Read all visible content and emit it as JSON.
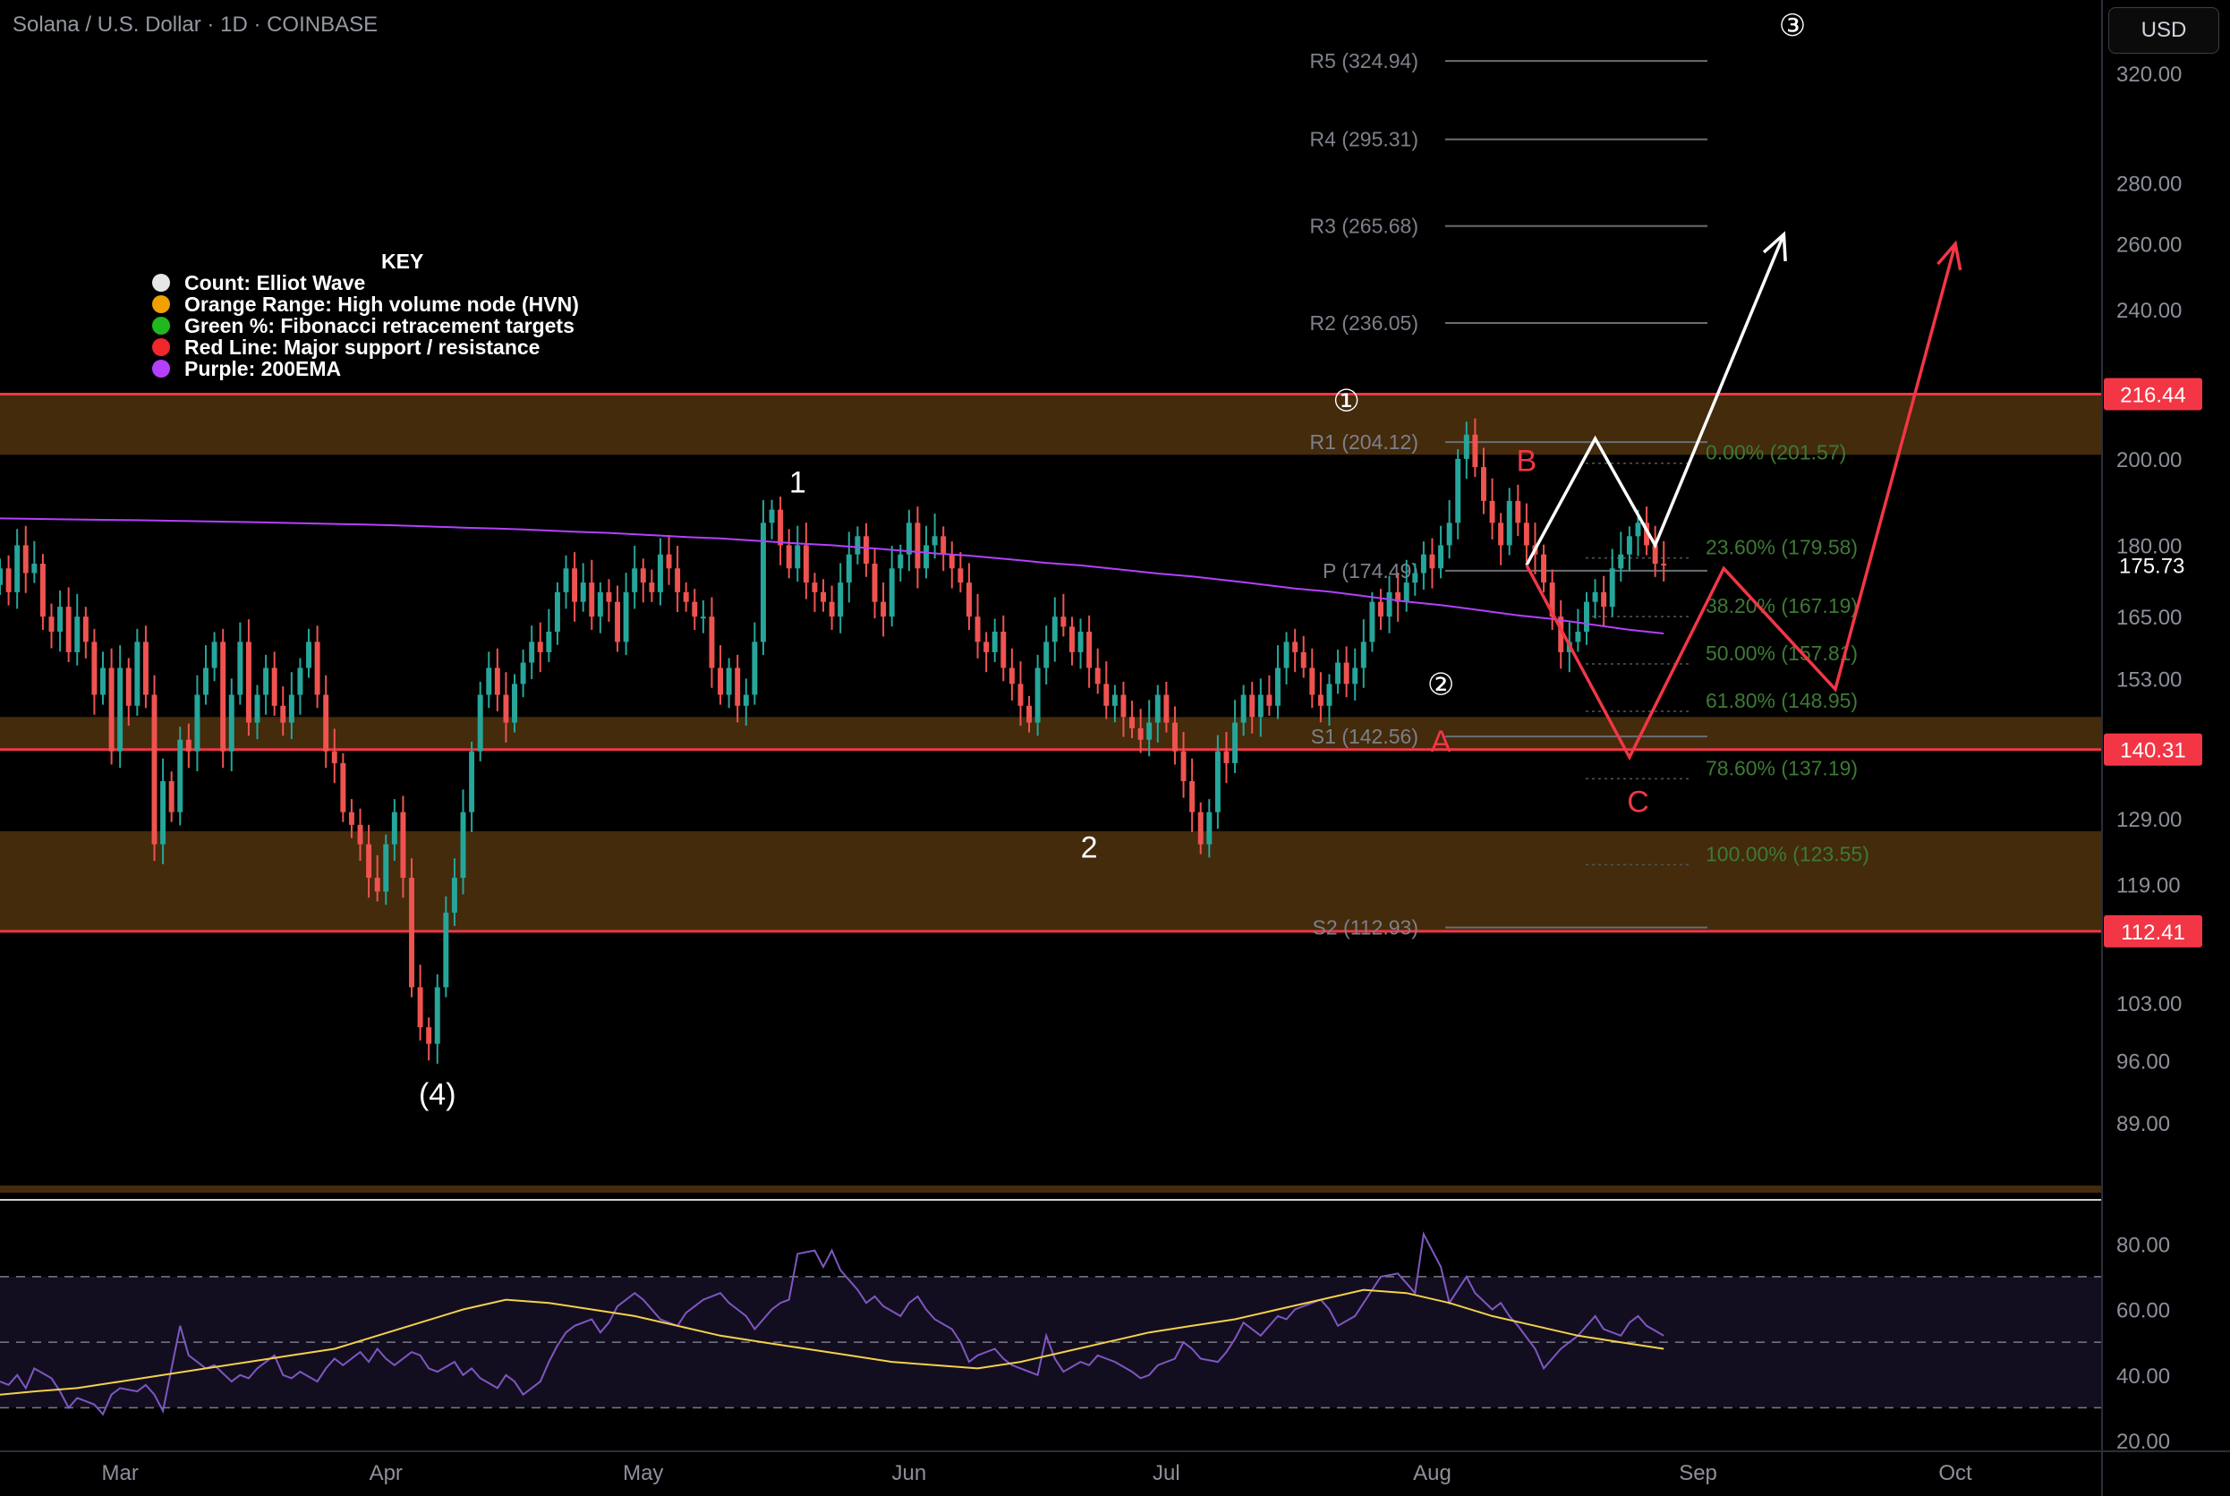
{
  "header": {
    "title": "Solana / U.S. Dollar · 1D · COINBASE",
    "currency_button": "USD"
  },
  "key": {
    "title": "KEY",
    "items": [
      {
        "label": "Count: Elliot Wave",
        "color": "#e6e6e6"
      },
      {
        "label": "Orange Range: High volume node (HVN)",
        "color": "#f0a000"
      },
      {
        "label": "Green %: Fibonacci retracement targets",
        "color": "#1fb81f"
      },
      {
        "label": "Red Line: Major support / resistance",
        "color": "#f0272b"
      },
      {
        "label": "Purple: 200EMA",
        "color": "#b340ff"
      }
    ]
  },
  "colors": {
    "up": "#26a69a",
    "down": "#ef5350",
    "ema": "#b340ff",
    "rsi": "#7e57c2",
    "rsi_ma": "#f5d04b",
    "support": "#f23645",
    "hvn": "#5a3a10",
    "fib": "#3d7a34",
    "pivot": "#6b6e76"
  },
  "chart_data": [
    {
      "type": "candlestick",
      "title": "Solana / U.S. Dollar · 1D · COINBASE",
      "x_axis": {
        "tick_labels": [
          "Mar",
          "Apr",
          "May",
          "Jun",
          "Jul",
          "Aug",
          "Sep",
          "Oct"
        ],
        "start": "2025-02-15",
        "end": "2025-10-18"
      },
      "y_axis": {
        "scale": "log",
        "range": [
          82,
          350
        ],
        "tick_labels": [
          "320.00",
          "280.00",
          "260.00",
          "240.00",
          "200.00",
          "180.00",
          "165.00",
          "153.00",
          "129.00",
          "119.00",
          "103.00",
          "96.00",
          "89.00"
        ]
      },
      "price_label": {
        "value": "175.73"
      },
      "support_resistance": [
        {
          "price": 216.44,
          "label": "216.44"
        },
        {
          "price": 140.31,
          "label": "140.31"
        },
        {
          "price": 112.41,
          "label": "112.41"
        }
      ],
      "hvn_zones": [
        [
          201,
          216.44
        ],
        [
          140.31,
          146
        ],
        [
          112.41,
          127
        ]
      ],
      "pivots": [
        {
          "label": "R5 (324.94)",
          "price": 324.94
        },
        {
          "label": "R4 (295.31)",
          "price": 295.31
        },
        {
          "label": "R3 (265.68)",
          "price": 265.68
        },
        {
          "label": "R2 (236.05)",
          "price": 236.05
        },
        {
          "label": "R1 (204.12)",
          "price": 204.12
        },
        {
          "label": "P (174.49)",
          "price": 174.49
        },
        {
          "label": "S1 (142.56)",
          "price": 142.56
        },
        {
          "label": "S2 (112.93)",
          "price": 112.93
        }
      ],
      "fib_levels": [
        {
          "label": "0.00% (201.57)",
          "price": 201.57
        },
        {
          "label": "23.60% (179.58)",
          "price": 179.58
        },
        {
          "label": "38.20% (167.19)",
          "price": 167.19
        },
        {
          "label": "50.00% (157.81)",
          "price": 157.81
        },
        {
          "label": "61.80% (148.95)",
          "price": 148.95
        },
        {
          "label": "78.60% (137.19)",
          "price": 137.19
        },
        {
          "label": "100.00% (123.55)",
          "price": 123.55
        }
      ],
      "wave_labels": [
        {
          "text": "1",
          "date": "2025-05-19",
          "price": 192,
          "color": "#ffffff"
        },
        {
          "text": "2",
          "date": "2025-06-22",
          "price": 123,
          "color": "#ffffff"
        },
        {
          "text": "(4)",
          "date": "2025-04-07",
          "price": 91,
          "color": "#ffffff"
        },
        {
          "text": "①",
          "date": "2025-07-22",
          "price": 212,
          "color": "#ffffff"
        },
        {
          "text": "②",
          "date": "2025-08-02",
          "price": 150,
          "color": "#ffffff"
        },
        {
          "text": "③",
          "date": "2025-09-12",
          "price": 335,
          "color": "#ffffff"
        },
        {
          "text": "B",
          "date": "2025-08-12",
          "price": 197,
          "color": "#f23645"
        },
        {
          "text": "A",
          "date": "2025-08-02",
          "price": 140,
          "color": "#f23645"
        },
        {
          "text": "C",
          "date": "2025-08-25",
          "price": 130,
          "color": "#f23645"
        }
      ],
      "projections": [
        {
          "color": "#ffffff",
          "points": [
            [
              "2025-08-12",
              175.7
            ],
            [
              "2025-08-20",
              205
            ],
            [
              "2025-08-27",
              180
            ],
            [
              "2025-09-11",
              263
            ]
          ]
        },
        {
          "color": "#f23645",
          "points": [
            [
              "2025-08-12",
              175.7
            ],
            [
              "2025-08-24",
              139
            ],
            [
              "2025-09-04",
              175
            ],
            [
              "2025-09-17",
              151
            ],
            [
              "2025-10-01",
              260
            ]
          ]
        }
      ],
      "series": [
        {
          "name": "SOL/USD",
          "x_start": "2025-02-15",
          "interval": "1D",
          "close": [
            175,
            170,
            180,
            174,
            176,
            165,
            162,
            167,
            158,
            165,
            160,
            150,
            155,
            140,
            155,
            148,
            160,
            150,
            125,
            135,
            130,
            142,
            140,
            150,
            155,
            160,
            140,
            150,
            160,
            145,
            150,
            155,
            148,
            145,
            150,
            155,
            160,
            150,
            140,
            138,
            130,
            128,
            125,
            120,
            118,
            125,
            130,
            120,
            105,
            100,
            98,
            105,
            115,
            120,
            130,
            140,
            150,
            155,
            150,
            145,
            152,
            156,
            160,
            158,
            162,
            170,
            175,
            168,
            172,
            165,
            170,
            168,
            160,
            170,
            175,
            172,
            170,
            178,
            175,
            170,
            168,
            165,
            165,
            155,
            150,
            155,
            148,
            150,
            160,
            185,
            188,
            180,
            175,
            180,
            172,
            170,
            168,
            165,
            172,
            178,
            182,
            176,
            168,
            165,
            175,
            178,
            185,
            175,
            180,
            182,
            178,
            175,
            172,
            165,
            160,
            158,
            162,
            155,
            152,
            148,
            145,
            155,
            160,
            165,
            163,
            158,
            162,
            155,
            152,
            148,
            150,
            146,
            144,
            142,
            145,
            150,
            145,
            140,
            135,
            130,
            125,
            130,
            140,
            138,
            145,
            150,
            146,
            150,
            148,
            155,
            160,
            158,
            155,
            150,
            148,
            152,
            156,
            152,
            155,
            160,
            168,
            165,
            170,
            168,
            172,
            174,
            178,
            175,
            180,
            185,
            200,
            206,
            198,
            190,
            185,
            180,
            190,
            185,
            180,
            178,
            172,
            165,
            158,
            160,
            162,
            168,
            170,
            167,
            175,
            178,
            182,
            185,
            180,
            176,
            175.73
          ],
          "low_min": 95.3,
          "high_max": 206.3
        },
        {
          "name": "200EMA",
          "start": 186,
          "end": 162
        }
      ]
    },
    {
      "type": "line",
      "title": "",
      "y_axis": {
        "range": [
          20,
          85
        ],
        "tick_labels": [
          "80.00",
          "60.00",
          "40.00",
          "20.00"
        ],
        "bands": [
          30,
          50,
          70
        ]
      },
      "series": [
        {
          "name": "RSI",
          "values": [
            38,
            37,
            40,
            36,
            42,
            39,
            35,
            30,
            33,
            31,
            28,
            34,
            36,
            35,
            37,
            34,
            29,
            55,
            46,
            44,
            42,
            43,
            38,
            40,
            39,
            42,
            46,
            40,
            39,
            41,
            38,
            42,
            45,
            43,
            47,
            44,
            48,
            45,
            43,
            47,
            46,
            42,
            41,
            44,
            40,
            42,
            39,
            36,
            40,
            38,
            34,
            38,
            44,
            49,
            53,
            55,
            57,
            53,
            56,
            61,
            65,
            63,
            60,
            57,
            55,
            59,
            61,
            63,
            65,
            62,
            60,
            58,
            54,
            60,
            62,
            63,
            77,
            78,
            73,
            78,
            72,
            66,
            62,
            64,
            61,
            58,
            62,
            64,
            60,
            57,
            54,
            50,
            44,
            46,
            48,
            45,
            43,
            42,
            40,
            52,
            45,
            41,
            44,
            43,
            46,
            45,
            44,
            41,
            39,
            40,
            43,
            45,
            50,
            48,
            45,
            44,
            47,
            51,
            56,
            52,
            55,
            58,
            57,
            60,
            62,
            63,
            60,
            55,
            58,
            62,
            66,
            70,
            71,
            68,
            65,
            83,
            73,
            62,
            66,
            70,
            65,
            60,
            62,
            58,
            55,
            48,
            42,
            45,
            48,
            52,
            55,
            58,
            54,
            52,
            56,
            58,
            55,
            52
          ],
          "color": "#7e57c2"
        },
        {
          "name": "RSI MA",
          "values": [
            34,
            35,
            36,
            38,
            40,
            42,
            44,
            46,
            48,
            52,
            56,
            60,
            63,
            62,
            60,
            58,
            55,
            52,
            50,
            48,
            46,
            44,
            43,
            42,
            44,
            47,
            50,
            53,
            55,
            57,
            60,
            63,
            66,
            65,
            62,
            58,
            55,
            52,
            50,
            48
          ],
          "color": "#f5d04b"
        }
      ]
    }
  ]
}
